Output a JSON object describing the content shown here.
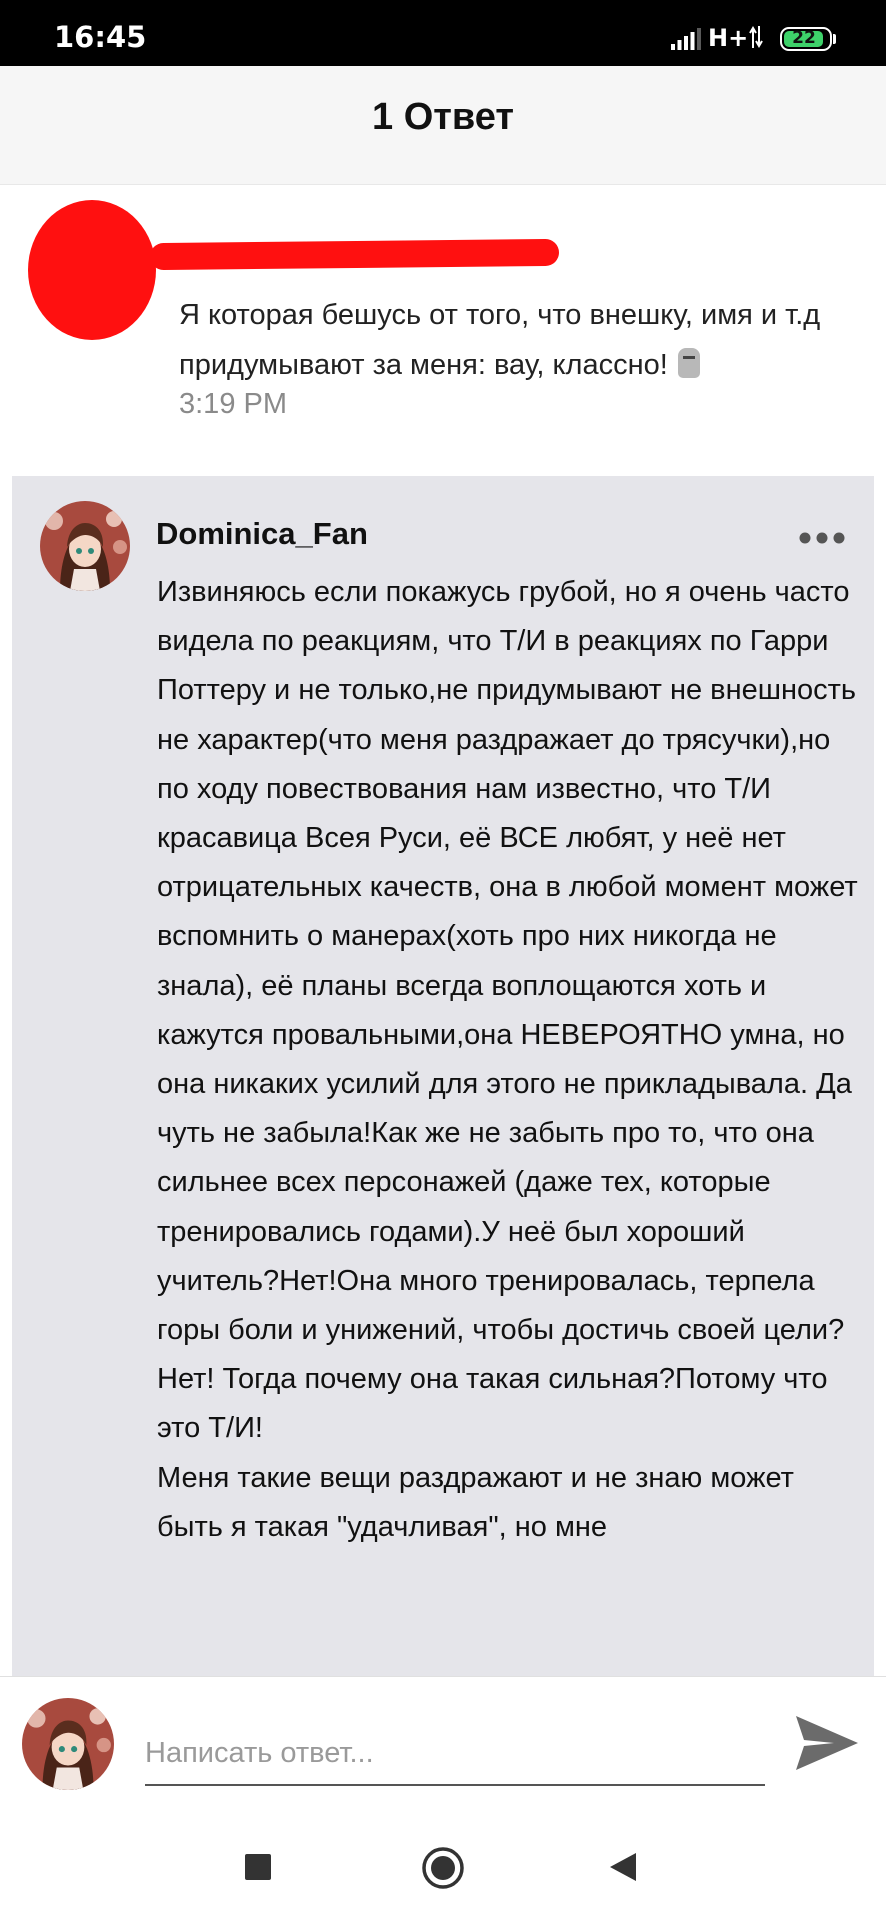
{
  "status_bar": {
    "time": "16:45",
    "network": "H+",
    "battery": "22",
    "battery_fraction": 0.22
  },
  "header": {
    "title": "1 Ответ"
  },
  "original_comment": {
    "text": "Я которая бешусь от того, что внешку, имя и т.д придумывают за меня: вау, классно!",
    "emoji": "moai-icon",
    "time": "3:19 PM"
  },
  "reply": {
    "username": "Dominica_Fan",
    "text": "Извиняюсь если покажусь грубой, но я очень часто видела по реакциям, что Т/И в реакциях по Гарри Поттеру и не только,не придумывают не внешность не характер(что меня раздражает до трясучки),но по ходу повествования нам известно, что Т/И красавица Всея Руси, её ВСЕ любят, у неё нет отрицательных качеств, она в любой момент может вспомнить о манерах(хоть про них никогда не знала), её планы всегда воплощаются хоть и кажутся провальными,она НЕВЕРОЯТНО умна, но она никаких усилий для этого не прикладывала. Да чуть не забыла!Как же не забыть про то, что она сильнее всех персонажей (даже тех, которые тренировались годами).У неё был хороший учитель?Нет!Она много тренировалась, терпела горы боли и унижений, чтобы достичь своей цели?Нет! Тогда почему она такая сильная?Потому что это Т/И!\nМеня такие вещи раздражают и не знаю может быть я такая \"удачливая\", но мне"
  },
  "compose": {
    "placeholder": "Написать ответ..."
  },
  "colors": {
    "redaction": "#ff1010",
    "reply_background": "#e5e5ea",
    "battery_fill": "#3ed26a"
  }
}
